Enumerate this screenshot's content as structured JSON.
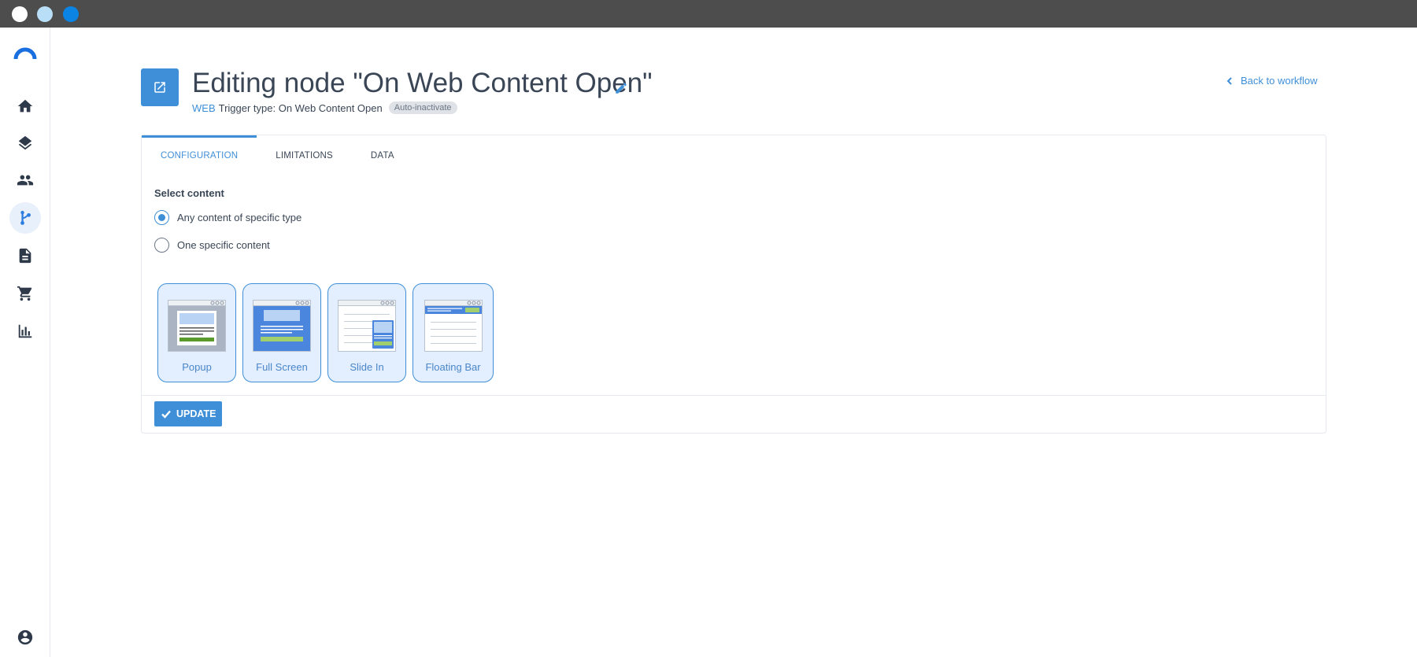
{
  "window": {
    "controls": [
      "close",
      "minimize",
      "maximize"
    ]
  },
  "sidebar": {
    "logo_icon": "brand-arc-icon",
    "items": [
      {
        "name": "home",
        "icon": "home-icon"
      },
      {
        "name": "layers",
        "icon": "layers-icon"
      },
      {
        "name": "people",
        "icon": "people-icon"
      },
      {
        "name": "workflow",
        "icon": "workflow-icon",
        "active": true
      },
      {
        "name": "document",
        "icon": "document-icon"
      },
      {
        "name": "cart",
        "icon": "cart-icon"
      },
      {
        "name": "analytics",
        "icon": "bar-chart-icon"
      },
      {
        "name": "account",
        "icon": "account-circle-icon"
      }
    ]
  },
  "header": {
    "icon": "external-link-icon",
    "title": "Editing node \"On Web Content Open\"",
    "channel": "WEB",
    "trigger_label": "Trigger type: On Web Content Open",
    "badge": "Auto-inactivate",
    "back_label": "Back to workflow"
  },
  "tabs": [
    {
      "label": "CONFIGURATION",
      "active": true
    },
    {
      "label": "LIMITATIONS",
      "active": false
    },
    {
      "label": "DATA",
      "active": false
    }
  ],
  "config": {
    "section_label": "Select content",
    "options": [
      {
        "label": "Any content of specific type",
        "checked": true
      },
      {
        "label": "One specific content",
        "checked": false
      }
    ],
    "content_types": [
      {
        "label": "Popup"
      },
      {
        "label": "Full Screen"
      },
      {
        "label": "Slide In"
      },
      {
        "label": "Floating Bar"
      }
    ]
  },
  "footer": {
    "update_label": "UPDATE"
  },
  "colors": {
    "accent": "#3f8fd8",
    "titlebar": "#4d4d4d",
    "card_selected_bg": "#e3efff"
  }
}
